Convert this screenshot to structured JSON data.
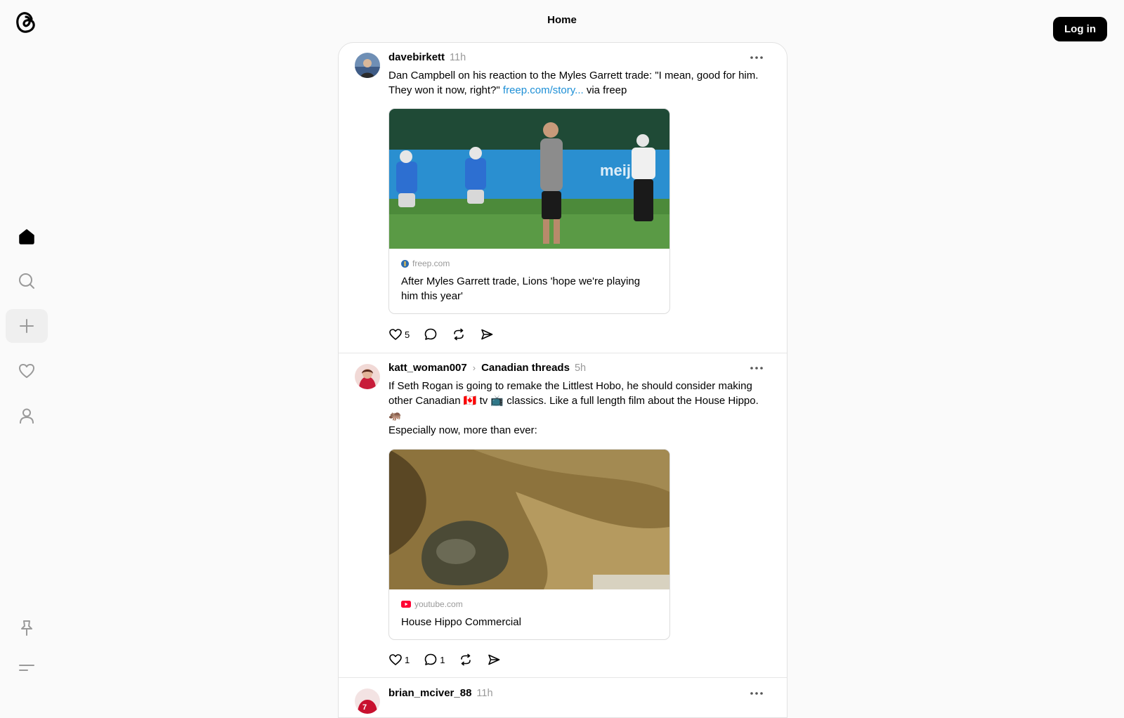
{
  "header": {
    "title": "Home",
    "login_label": "Log in"
  },
  "sidebar": {
    "items": [
      {
        "name": "home",
        "icon": "home-icon",
        "active": true
      },
      {
        "name": "search",
        "icon": "search-icon"
      },
      {
        "name": "create",
        "icon": "plus-icon"
      },
      {
        "name": "activity",
        "icon": "heart-icon"
      },
      {
        "name": "profile",
        "icon": "person-icon"
      }
    ],
    "bottom": [
      {
        "name": "pin",
        "icon": "pin-icon"
      },
      {
        "name": "menu",
        "icon": "menu-icon"
      }
    ]
  },
  "posts": [
    {
      "username": "davebirkett",
      "time": "11h",
      "text_before_link": "Dan Campbell on his reaction to the Myles Garrett trade: \"I mean, good for him. They won it now, right?\" ",
      "link_text": "freep.com/story...",
      "text_after_link": " via freep",
      "card": {
        "domain": "freep.com",
        "title": "After Myles Garrett trade, Lions 'hope we're playing him this year'"
      },
      "likes": "5"
    },
    {
      "username": "katt_woman007",
      "community": "Canadian threads",
      "time": "5h",
      "text_line1": "If Seth Rogan is going to remake the Littlest Hobo, he should consider making other Canadian 🇨🇦 tv 📺 classics. Like a full length film about the House Hippo. 🦛",
      "text_line2": "Especially now, more than ever:",
      "card": {
        "domain": "youtube.com",
        "title": "House Hippo Commercial"
      },
      "likes": "1",
      "replies": "1"
    },
    {
      "username": "brian_mciver_88",
      "time": "11h"
    }
  ],
  "colors": {
    "link": "#1d8fd6",
    "button_bg": "#000000",
    "youtube_red": "#ff0033"
  }
}
